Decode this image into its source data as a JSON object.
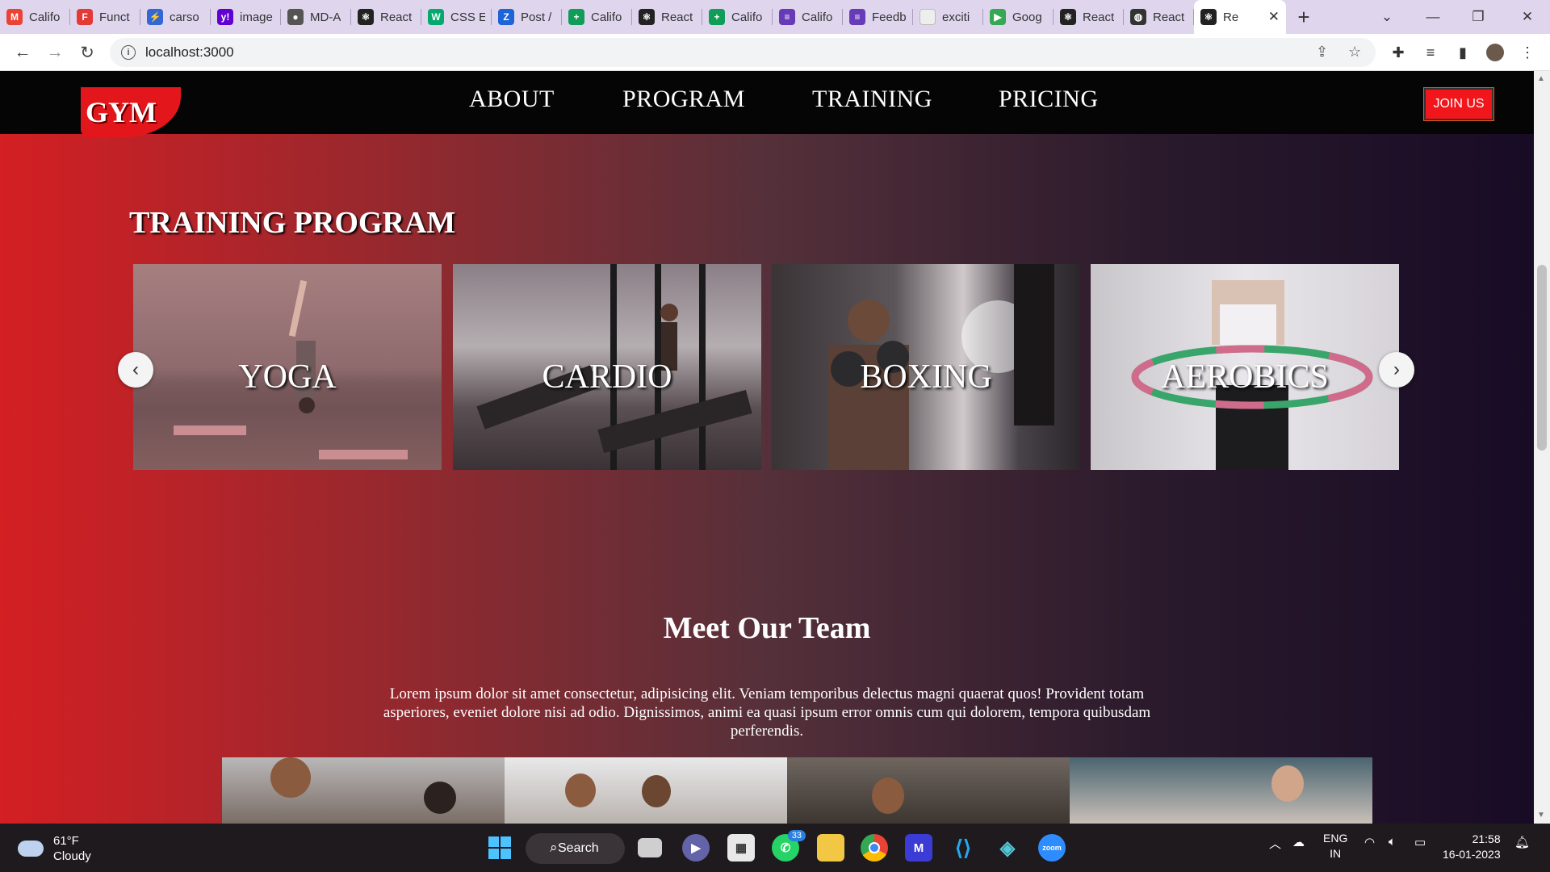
{
  "browser": {
    "tabs": [
      {
        "label": "Califo",
        "icon": "gmail-icon",
        "color": "#ea4335",
        "glyph": "M"
      },
      {
        "label": "Funct",
        "icon": "shield-icon",
        "color": "#e53935",
        "glyph": "F"
      },
      {
        "label": "carso",
        "icon": "bolt-icon",
        "color": "#3367d6",
        "glyph": "⚡"
      },
      {
        "label": "image",
        "icon": "yahoo-icon",
        "color": "#6001d2",
        "glyph": "y!"
      },
      {
        "label": "MD-A",
        "icon": "github-icon",
        "color": "#555555",
        "glyph": "●"
      },
      {
        "label": "React",
        "icon": "react-icon",
        "color": "#222222",
        "glyph": "⚛"
      },
      {
        "label": "CSS E",
        "icon": "w3-icon",
        "color": "#04aa6d",
        "glyph": "W"
      },
      {
        "label": "Post /",
        "icon": "zoho-icon",
        "color": "#1e63d7",
        "glyph": "Z"
      },
      {
        "label": "Califo",
        "icon": "sheets-icon",
        "color": "#0f9d58",
        "glyph": "+"
      },
      {
        "label": "React",
        "icon": "react-icon",
        "color": "#222222",
        "glyph": "⚛"
      },
      {
        "label": "Califo",
        "icon": "sheets-icon",
        "color": "#0f9d58",
        "glyph": "+"
      },
      {
        "label": "Califo",
        "icon": "forms-icon",
        "color": "#673ab7",
        "glyph": "≡"
      },
      {
        "label": "Feedb",
        "icon": "forms-icon",
        "color": "#673ab7",
        "glyph": "≡"
      },
      {
        "label": "exciti",
        "icon": "blank-page-icon",
        "color": "#eeeeee",
        "glyph": ""
      },
      {
        "label": "Goog",
        "icon": "meet-icon",
        "color": "#34a853",
        "glyph": "▶"
      },
      {
        "label": "React",
        "icon": "react-icon",
        "color": "#222222",
        "glyph": "⚛"
      },
      {
        "label": "React",
        "icon": "globe-icon",
        "color": "#333333",
        "glyph": "◍"
      }
    ],
    "active_tab": {
      "label": "Re",
      "icon": "react-icon",
      "color": "#222222",
      "glyph": "⚛"
    },
    "url": "localhost:3000"
  },
  "site": {
    "logo_text": "GYM",
    "menu": [
      "ABOUT",
      "PROGRAM",
      "TRAINING",
      "PRICING"
    ],
    "join_label": "JOIN US",
    "training_title": "TRAINING PROGRAM",
    "programs": [
      "YOGA",
      "CARDIO",
      "BOXING",
      "AEROBICS"
    ],
    "team_title": "Meet Our Team",
    "team_text": "Lorem ipsum dolor sit amet consectetur, adipisicing elit. Veniam temporibus delectus magni quaerat quos! Provident totam asperiores, eveniet dolore nisi ad odio. Dignissimos, animi ea quasi ipsum error omnis cum qui dolorem, tempora quibusdam perferendis.",
    "colors": {
      "accent": "#e3171b",
      "nav_bg": "#050505",
      "gradient_start": "#d41f23",
      "gradient_end": "#180b25"
    }
  },
  "taskbar": {
    "temperature": "61°F",
    "condition": "Cloudy",
    "search_label": "Search",
    "whatsapp_badge": "33",
    "language": "ENG",
    "region": "IN",
    "time": "21:58",
    "date": "16-01-2023"
  }
}
